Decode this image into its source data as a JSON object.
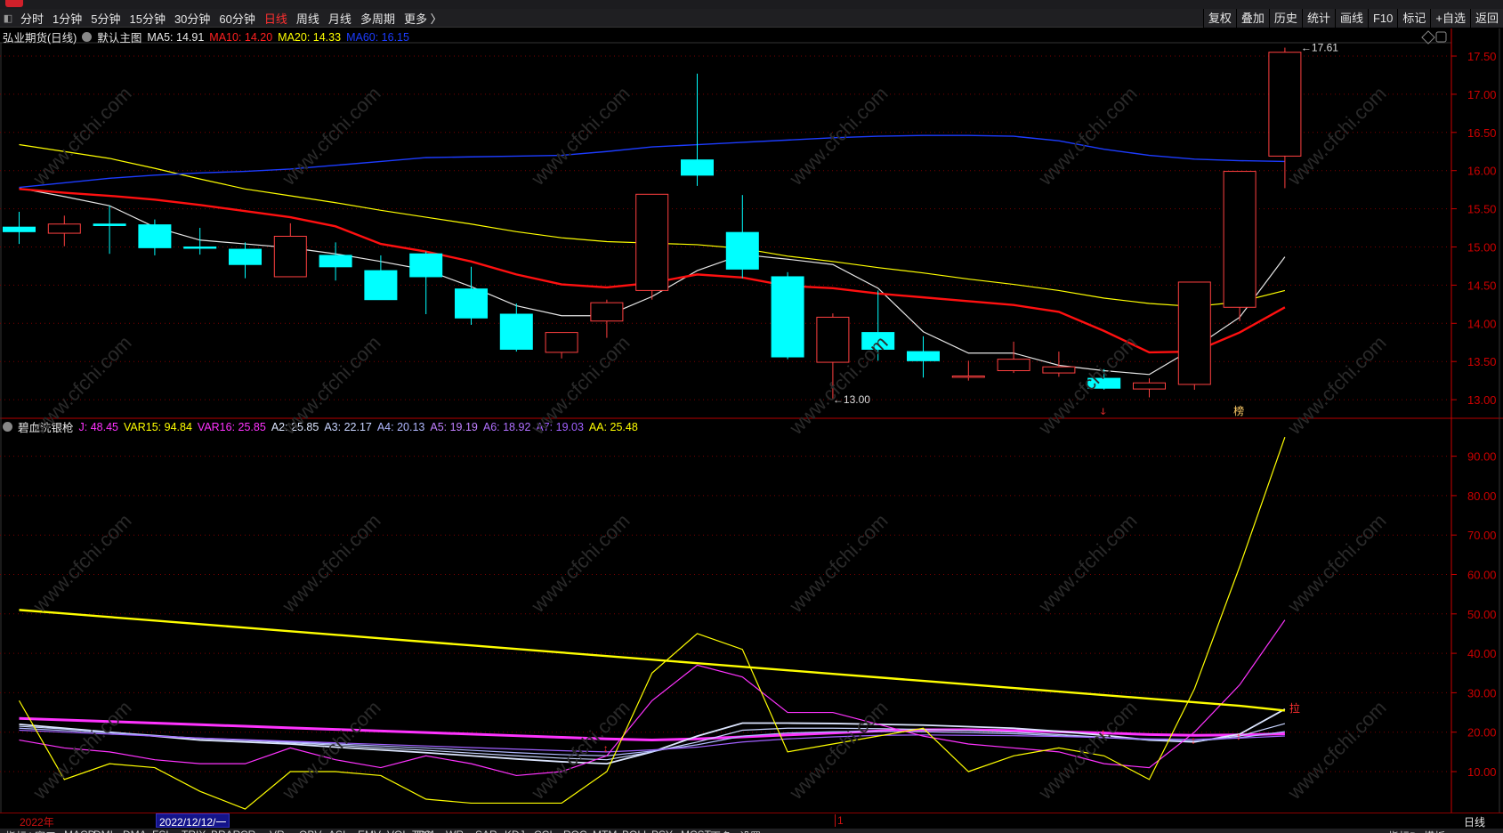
{
  "toolbar": {
    "periods": [
      "分时",
      "1分钟",
      "5分钟",
      "15分钟",
      "30分钟",
      "60分钟",
      "日线",
      "周线",
      "月线",
      "多周期",
      "更多 〉"
    ],
    "active_index": 6,
    "right_buttons": [
      "复权",
      "叠加",
      "历史",
      "统计",
      "画线",
      "F10",
      "标记",
      "+自选",
      "返回"
    ]
  },
  "main_legend": {
    "symbol": "弘业期货(日线)",
    "template": "默认主图",
    "items": [
      {
        "label": "MA5: 14.91",
        "color": "#e6e6e6"
      },
      {
        "label": "MA10: 14.20",
        "color": "#ff2020"
      },
      {
        "label": "MA20: 14.33",
        "color": "#ffff00"
      },
      {
        "label": "MA60: 16.15",
        "color": "#1c3cff"
      }
    ]
  },
  "sub_legend": {
    "name": "碧血洗银枪",
    "items": [
      {
        "label": "J: 48.45",
        "color": "#ff33ff"
      },
      {
        "label": "VAR15: 94.84",
        "color": "#ffff00"
      },
      {
        "label": "VAR16: 25.85",
        "color": "#ff33ff"
      },
      {
        "label": "A2: 25.85",
        "color": "#dde6ff"
      },
      {
        "label": "A3: 22.17",
        "color": "#c8d4ff"
      },
      {
        "label": "A4: 20.13",
        "color": "#b0b8ff"
      },
      {
        "label": "A5: 19.19",
        "color": "#c080ff"
      },
      {
        "label": "A6: 18.92",
        "color": "#b070ff"
      },
      {
        "label": "A7: 19.03",
        "color": "#a060ff"
      },
      {
        "label": "AA: 25.48",
        "color": "#ffff00"
      }
    ]
  },
  "colors": {
    "up": "#ff4040",
    "down": "#00ffff",
    "axis": "#cc0000",
    "grid": "#7a0000"
  },
  "price_axis": {
    "labels": [
      "17.50",
      "17.00",
      "16.50",
      "16.00",
      "15.50",
      "15.00",
      "14.50",
      "14.00",
      "13.50",
      "13.00"
    ],
    "range": [
      12.8,
      17.8
    ]
  },
  "sub_axis": {
    "labels": [
      "90.00",
      "80.00",
      "70.00",
      "60.00",
      "50.00",
      "40.00",
      "30.00",
      "20.00",
      "10.00"
    ],
    "range": [
      0,
      100
    ]
  },
  "annotations": {
    "high": "17.61",
    "low": "13.00",
    "signal_a": "拉",
    "marker_1": "ↆ",
    "marker_2": "榜"
  },
  "chart_data": {
    "type": "candlestick",
    "ohlc": [
      [
        15.26,
        15.46,
        15.04,
        15.2
      ],
      [
        15.18,
        15.41,
        15.01,
        15.3
      ],
      [
        15.3,
        15.54,
        14.91,
        15.28
      ],
      [
        15.29,
        15.36,
        14.89,
        14.99
      ],
      [
        15.0,
        15.25,
        14.9,
        14.99
      ],
      [
        14.97,
        15.06,
        14.59,
        14.77
      ],
      [
        14.61,
        15.31,
        14.61,
        15.14
      ],
      [
        14.89,
        15.06,
        14.56,
        14.74
      ],
      [
        14.69,
        14.89,
        14.31,
        14.31
      ],
      [
        14.91,
        14.94,
        14.12,
        14.61
      ],
      [
        14.45,
        14.74,
        13.98,
        14.07
      ],
      [
        14.12,
        14.26,
        13.63,
        13.66
      ],
      [
        13.62,
        13.88,
        13.54,
        13.88
      ],
      [
        14.03,
        14.31,
        13.81,
        14.27
      ],
      [
        14.43,
        15.69,
        14.31,
        15.69
      ],
      [
        16.14,
        17.27,
        15.8,
        15.94
      ],
      [
        15.19,
        15.68,
        14.59,
        14.71
      ],
      [
        14.61,
        14.67,
        13.53,
        13.56
      ],
      [
        13.49,
        14.13,
        13.0,
        14.08
      ],
      [
        13.88,
        14.43,
        13.51,
        13.66
      ],
      [
        13.63,
        13.83,
        13.29,
        13.51
      ],
      [
        13.3,
        13.51,
        13.25,
        13.31
      ],
      [
        13.38,
        13.76,
        13.35,
        13.53
      ],
      [
        13.35,
        13.63,
        13.3,
        13.43
      ],
      [
        13.28,
        13.4,
        13.13,
        13.15
      ],
      [
        13.14,
        13.28,
        13.03,
        13.22
      ],
      [
        13.2,
        14.54,
        13.13,
        14.54
      ],
      [
        14.21,
        15.99,
        14.03,
        15.99
      ],
      [
        16.19,
        17.61,
        15.77,
        17.55
      ]
    ],
    "ma": [
      {
        "name": "MA5",
        "color": "#e6e6e6",
        "width": 1.2,
        "values": [
          15.77,
          15.66,
          15.54,
          15.26,
          15.09,
          15.04,
          14.99,
          14.91,
          14.81,
          14.7,
          14.48,
          14.23,
          14.1,
          14.1,
          14.35,
          14.69,
          14.9,
          14.84,
          14.77,
          14.46,
          13.89,
          13.61,
          13.61,
          13.45,
          13.38,
          13.33,
          13.68,
          14.08,
          14.87
        ]
      },
      {
        "name": "MA10",
        "color": "#ff1010",
        "width": 2.4,
        "values": [
          15.76,
          15.71,
          15.67,
          15.62,
          15.55,
          15.47,
          15.39,
          15.27,
          15.04,
          14.94,
          14.81,
          14.64,
          14.51,
          14.47,
          14.53,
          14.64,
          14.6,
          14.49,
          14.46,
          14.39,
          14.34,
          14.29,
          14.24,
          14.15,
          13.9,
          13.62,
          13.63,
          13.88,
          14.21
        ]
      },
      {
        "name": "MA20",
        "color": "#ffff00",
        "width": 1.2,
        "values": [
          16.34,
          16.25,
          16.16,
          16.03,
          15.89,
          15.76,
          15.67,
          15.58,
          15.48,
          15.39,
          15.3,
          15.2,
          15.12,
          15.07,
          15.05,
          15.03,
          14.98,
          14.88,
          14.81,
          14.73,
          14.66,
          14.58,
          14.51,
          14.43,
          14.33,
          14.26,
          14.22,
          14.28,
          14.43
        ]
      },
      {
        "name": "MA60",
        "color": "#1c3cff",
        "width": 1.4,
        "values": [
          15.78,
          15.84,
          15.9,
          15.94,
          15.97,
          15.99,
          16.02,
          16.07,
          16.12,
          16.17,
          16.18,
          16.19,
          16.2,
          16.25,
          16.31,
          16.34,
          16.37,
          16.4,
          16.43,
          16.45,
          16.46,
          16.46,
          16.45,
          16.39,
          16.28,
          16.2,
          16.15,
          16.13,
          16.12
        ]
      }
    ],
    "sub_series": [
      {
        "name": "VAR16",
        "color": "#ff33ff",
        "width": 3,
        "values": [
          23.5,
          23.1,
          22.7,
          22.3,
          21.9,
          21.5,
          21.1,
          20.7,
          20.3,
          19.9,
          19.5,
          19.1,
          18.7,
          18.3,
          18.0,
          18.3,
          18.8,
          19.3,
          19.8,
          20.3,
          20.6,
          20.6,
          20.4,
          20.1,
          19.8,
          19.4,
          19.2,
          19.3,
          19.6
        ]
      },
      {
        "name": "A2",
        "color": "#dde6ff",
        "width": 1.8,
        "values": [
          22,
          21,
          20,
          19,
          18,
          17.5,
          17,
          16.2,
          15.5,
          14.8,
          14,
          13.2,
          12.5,
          12,
          15,
          19,
          22.3,
          22.3,
          22.2,
          22,
          21.8,
          21.4,
          21,
          20.2,
          19.2,
          18,
          17.5,
          19.5,
          25.85
        ]
      },
      {
        "name": "A3",
        "color": "#c8d4ff",
        "width": 1.2,
        "values": [
          21.5,
          20.8,
          20,
          19.2,
          18.4,
          17.9,
          17.3,
          16.7,
          16,
          15.4,
          14.7,
          14,
          13.4,
          13,
          15,
          17.5,
          20.5,
          21,
          21,
          20.9,
          20.7,
          20.4,
          20,
          19.4,
          18.7,
          18,
          17.6,
          19,
          22.17
        ]
      },
      {
        "name": "A4",
        "color": "#b0b8ff",
        "width": 1.2,
        "values": [
          21,
          20.4,
          19.8,
          19.1,
          18.5,
          18,
          17.5,
          17,
          16.5,
          16,
          15.4,
          14.8,
          14.3,
          14,
          15.2,
          16.8,
          19,
          19.8,
          20.1,
          20.2,
          20.1,
          19.9,
          19.6,
          19.1,
          18.6,
          18.1,
          17.8,
          18.6,
          20.13
        ]
      },
      {
        "name": "A7",
        "color": "#a060ff",
        "width": 1.2,
        "values": [
          20.5,
          20,
          19.5,
          19,
          18.5,
          18.1,
          17.7,
          17.3,
          16.9,
          16.5,
          16.1,
          15.7,
          15.3,
          15,
          15.5,
          16.2,
          17.5,
          18.3,
          18.8,
          19.2,
          19.3,
          19.2,
          19.1,
          18.9,
          18.6,
          18.3,
          18.2,
          18.5,
          19.03
        ]
      },
      {
        "name": "J",
        "color": "#ff33ff",
        "width": 1.2,
        "values": [
          18,
          16,
          15,
          13,
          12,
          12,
          16,
          13,
          11,
          14,
          12,
          9,
          10,
          14,
          28,
          37,
          34,
          25,
          25,
          22,
          19,
          17,
          16,
          15,
          12,
          11,
          20,
          32,
          48.45
        ]
      },
      {
        "name": "VAR15",
        "color": "#ffff00",
        "width": 1.2,
        "values": [
          28,
          8,
          12,
          11,
          5,
          0.5,
          10,
          10,
          9,
          3,
          2,
          2,
          2,
          10,
          35,
          45,
          41,
          15,
          17,
          19,
          21,
          10,
          14,
          16,
          14,
          8,
          31,
          62,
          94.84
        ]
      },
      {
        "name": "AA",
        "color": "#ffff00",
        "width": 2.4,
        "values": [
          51,
          50.1,
          49.2,
          48.3,
          47.4,
          46.5,
          45.6,
          44.7,
          43.8,
          42.9,
          42,
          41.1,
          40.2,
          39.3,
          38.4,
          37.5,
          36.6,
          35.7,
          34.8,
          33.9,
          33,
          32.1,
          31.2,
          30.3,
          29.4,
          28.5,
          27.6,
          26.7,
          25.48
        ]
      }
    ]
  },
  "datebar": {
    "year": "2022年",
    "cursor_date": "2022/12/12/一",
    "marker": "1",
    "period": "日线"
  },
  "bottom_tabs": [
    "指标A",
    "窗口",
    "MACD",
    "DMI",
    "DMA",
    "FSL",
    "TRIX",
    "BRAR",
    "CR",
    "VR",
    "OBV",
    "ASI",
    "EMV",
    "VOL-TDX",
    "RSI",
    "WR",
    "SAR",
    "KDJ",
    "CCI",
    "ROC",
    "MTM",
    "BOLL",
    "PSY",
    "MCST",
    "更多",
    "设置"
  ],
  "bottom_right_tabs": [
    "指标B",
    "模板"
  ],
  "watermark": "www.cfchi.com"
}
